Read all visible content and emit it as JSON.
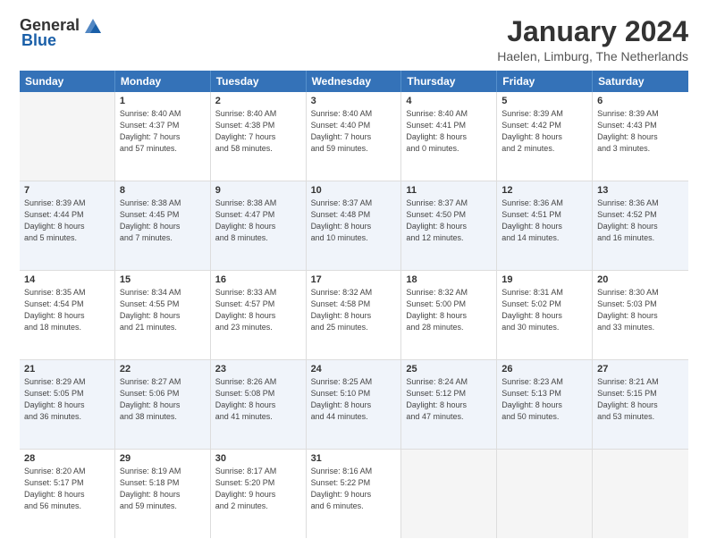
{
  "header": {
    "logo": {
      "general": "General",
      "blue": "Blue"
    },
    "title": "January 2024",
    "location": "Haelen, Limburg, The Netherlands"
  },
  "calendar": {
    "weekdays": [
      "Sunday",
      "Monday",
      "Tuesday",
      "Wednesday",
      "Thursday",
      "Friday",
      "Saturday"
    ],
    "rows": [
      [
        {
          "day": "",
          "detail": ""
        },
        {
          "day": "1",
          "detail": "Sunrise: 8:40 AM\nSunset: 4:37 PM\nDaylight: 7 hours\nand 57 minutes."
        },
        {
          "day": "2",
          "detail": "Sunrise: 8:40 AM\nSunset: 4:38 PM\nDaylight: 7 hours\nand 58 minutes."
        },
        {
          "day": "3",
          "detail": "Sunrise: 8:40 AM\nSunset: 4:40 PM\nDaylight: 7 hours\nand 59 minutes."
        },
        {
          "day": "4",
          "detail": "Sunrise: 8:40 AM\nSunset: 4:41 PM\nDaylight: 8 hours\nand 0 minutes."
        },
        {
          "day": "5",
          "detail": "Sunrise: 8:39 AM\nSunset: 4:42 PM\nDaylight: 8 hours\nand 2 minutes."
        },
        {
          "day": "6",
          "detail": "Sunrise: 8:39 AM\nSunset: 4:43 PM\nDaylight: 8 hours\nand 3 minutes."
        }
      ],
      [
        {
          "day": "7",
          "detail": "Sunrise: 8:39 AM\nSunset: 4:44 PM\nDaylight: 8 hours\nand 5 minutes."
        },
        {
          "day": "8",
          "detail": "Sunrise: 8:38 AM\nSunset: 4:45 PM\nDaylight: 8 hours\nand 7 minutes."
        },
        {
          "day": "9",
          "detail": "Sunrise: 8:38 AM\nSunset: 4:47 PM\nDaylight: 8 hours\nand 8 minutes."
        },
        {
          "day": "10",
          "detail": "Sunrise: 8:37 AM\nSunset: 4:48 PM\nDaylight: 8 hours\nand 10 minutes."
        },
        {
          "day": "11",
          "detail": "Sunrise: 8:37 AM\nSunset: 4:50 PM\nDaylight: 8 hours\nand 12 minutes."
        },
        {
          "day": "12",
          "detail": "Sunrise: 8:36 AM\nSunset: 4:51 PM\nDaylight: 8 hours\nand 14 minutes."
        },
        {
          "day": "13",
          "detail": "Sunrise: 8:36 AM\nSunset: 4:52 PM\nDaylight: 8 hours\nand 16 minutes."
        }
      ],
      [
        {
          "day": "14",
          "detail": "Sunrise: 8:35 AM\nSunset: 4:54 PM\nDaylight: 8 hours\nand 18 minutes."
        },
        {
          "day": "15",
          "detail": "Sunrise: 8:34 AM\nSunset: 4:55 PM\nDaylight: 8 hours\nand 21 minutes."
        },
        {
          "day": "16",
          "detail": "Sunrise: 8:33 AM\nSunset: 4:57 PM\nDaylight: 8 hours\nand 23 minutes."
        },
        {
          "day": "17",
          "detail": "Sunrise: 8:32 AM\nSunset: 4:58 PM\nDaylight: 8 hours\nand 25 minutes."
        },
        {
          "day": "18",
          "detail": "Sunrise: 8:32 AM\nSunset: 5:00 PM\nDaylight: 8 hours\nand 28 minutes."
        },
        {
          "day": "19",
          "detail": "Sunrise: 8:31 AM\nSunset: 5:02 PM\nDaylight: 8 hours\nand 30 minutes."
        },
        {
          "day": "20",
          "detail": "Sunrise: 8:30 AM\nSunset: 5:03 PM\nDaylight: 8 hours\nand 33 minutes."
        }
      ],
      [
        {
          "day": "21",
          "detail": "Sunrise: 8:29 AM\nSunset: 5:05 PM\nDaylight: 8 hours\nand 36 minutes."
        },
        {
          "day": "22",
          "detail": "Sunrise: 8:27 AM\nSunset: 5:06 PM\nDaylight: 8 hours\nand 38 minutes."
        },
        {
          "day": "23",
          "detail": "Sunrise: 8:26 AM\nSunset: 5:08 PM\nDaylight: 8 hours\nand 41 minutes."
        },
        {
          "day": "24",
          "detail": "Sunrise: 8:25 AM\nSunset: 5:10 PM\nDaylight: 8 hours\nand 44 minutes."
        },
        {
          "day": "25",
          "detail": "Sunrise: 8:24 AM\nSunset: 5:12 PM\nDaylight: 8 hours\nand 47 minutes."
        },
        {
          "day": "26",
          "detail": "Sunrise: 8:23 AM\nSunset: 5:13 PM\nDaylight: 8 hours\nand 50 minutes."
        },
        {
          "day": "27",
          "detail": "Sunrise: 8:21 AM\nSunset: 5:15 PM\nDaylight: 8 hours\nand 53 minutes."
        }
      ],
      [
        {
          "day": "28",
          "detail": "Sunrise: 8:20 AM\nSunset: 5:17 PM\nDaylight: 8 hours\nand 56 minutes."
        },
        {
          "day": "29",
          "detail": "Sunrise: 8:19 AM\nSunset: 5:18 PM\nDaylight: 8 hours\nand 59 minutes."
        },
        {
          "day": "30",
          "detail": "Sunrise: 8:17 AM\nSunset: 5:20 PM\nDaylight: 9 hours\nand 2 minutes."
        },
        {
          "day": "31",
          "detail": "Sunrise: 8:16 AM\nSunset: 5:22 PM\nDaylight: 9 hours\nand 6 minutes."
        },
        {
          "day": "",
          "detail": ""
        },
        {
          "day": "",
          "detail": ""
        },
        {
          "day": "",
          "detail": ""
        }
      ]
    ]
  }
}
